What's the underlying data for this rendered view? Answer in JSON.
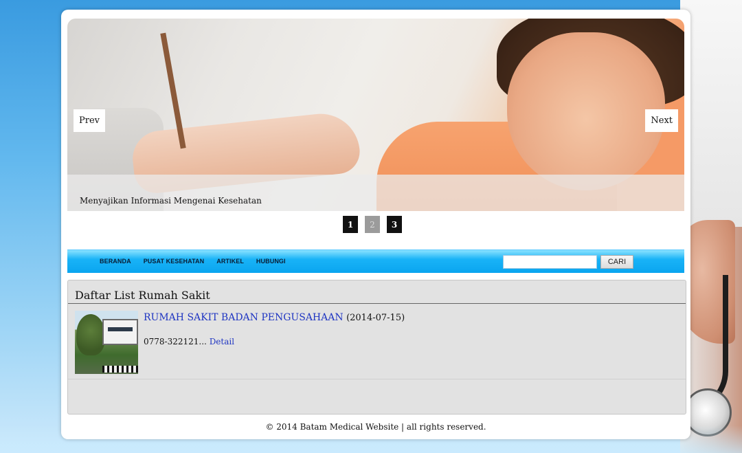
{
  "slider": {
    "prev_label": "Prev",
    "next_label": "Next",
    "caption": "Menyajikan Informasi Mengenai Kesehatan",
    "pages": [
      "1",
      "2",
      "3"
    ],
    "active_page": "2"
  },
  "menu": {
    "items": [
      "BERANDA",
      "PUSAT KESEHATAN",
      "ARTIKEL",
      "HUBUNGI"
    ],
    "search_placeholder": "",
    "search_button": "CARI"
  },
  "content": {
    "title": "Daftar List Rumah Sakit",
    "items": [
      {
        "name": "RUMAH SAKIT BADAN PENGUSAHAAN",
        "date": "(2014-07-15)",
        "phone": "0778-322121...",
        "detail_label": "Detail"
      }
    ]
  },
  "footer": {
    "text": "© 2014 Batam Medical Website | all rights reserved."
  },
  "colors": {
    "menu_bar": "#19b3f7",
    "link": "#1f35c2",
    "panel_bg": "#e2e2e2"
  }
}
